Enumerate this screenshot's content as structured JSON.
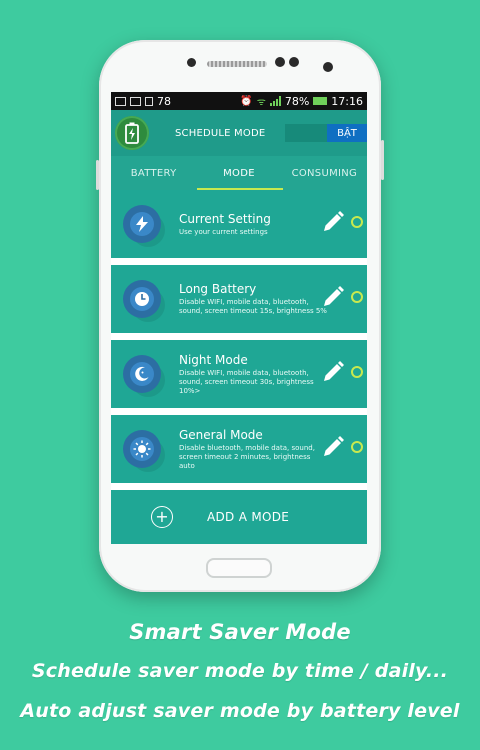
{
  "status_bar": {
    "notif_count": "78",
    "battery_percent": "78%",
    "time": "17:16"
  },
  "app_bar": {
    "title": "SCHEDULE MODE",
    "toggle_label": "BẬT"
  },
  "tabs": [
    {
      "label": "BATTERY",
      "active": false
    },
    {
      "label": "MODE",
      "active": true
    },
    {
      "label": "CONSUMING",
      "active": false
    }
  ],
  "modes": [
    {
      "name": "Current Setting",
      "desc": "Use your current settings",
      "icon": "lightning-icon"
    },
    {
      "name": "Long Battery",
      "desc": "Disable WIFI, mobile data, bluetooth, sound, screen timeout 15s, brightness 5%",
      "icon": "clock-icon"
    },
    {
      "name": "Night Mode",
      "desc": "Disable WIFI, mobile data, bluetooth, sound, screen timeout 30s, brightness 10%>",
      "icon": "moon-icon"
    },
    {
      "name": "General Mode",
      "desc": "Disable bluetooth, mobile data, sound, screen timeout 2 minutes, brightness auto",
      "icon": "sun-icon"
    }
  ],
  "add_mode_label": "ADD A MODE",
  "captions": {
    "line1": "Smart Saver Mode",
    "line2": "Schedule saver mode by time / daily...",
    "line3": "Auto adjust saver mode by battery level"
  },
  "colors": {
    "background": "#3ecb9f",
    "app_bar": "#1f9b8a",
    "card": "#1fa795",
    "accent": "#c8e94f",
    "toggle_on": "#0f6fc2"
  }
}
